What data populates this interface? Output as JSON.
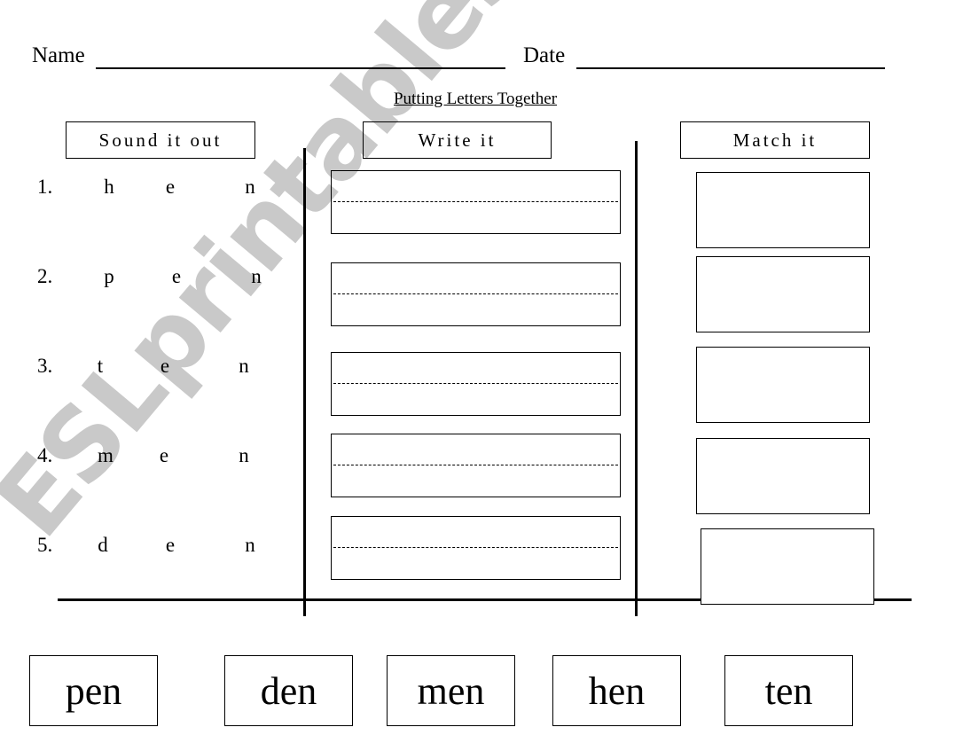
{
  "header": {
    "name_label": "Name",
    "date_label": "Date",
    "title": "Putting Letters Together"
  },
  "columns": {
    "sound": "Sound it out",
    "write": "Write it",
    "match": "Match it"
  },
  "items": [
    {
      "number": "1.",
      "letters": [
        "h",
        "e",
        "n"
      ]
    },
    {
      "number": "2.",
      "letters": [
        "p",
        "e",
        "n"
      ]
    },
    {
      "number": "3.",
      "letters": [
        "t",
        "e",
        "n"
      ]
    },
    {
      "number": "4.",
      "letters": [
        "m",
        "e",
        "n"
      ]
    },
    {
      "number": "5.",
      "letters": [
        "d",
        "e",
        "n"
      ]
    }
  ],
  "word_bank": [
    "pen",
    "den",
    "men",
    "hen",
    "ten"
  ],
  "watermark": "ESLprintables.com",
  "colors": {
    "ink": "#000000",
    "watermark": "#c9c9c9",
    "paper": "#ffffff"
  }
}
